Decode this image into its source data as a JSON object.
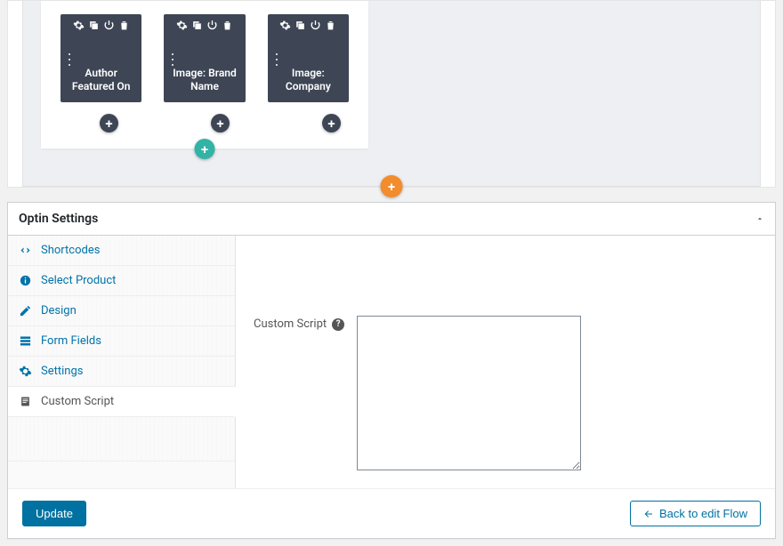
{
  "editor": {
    "modules": [
      {
        "title": "Author Featured On"
      },
      {
        "title": "Image: Brand Name"
      },
      {
        "title": "Image: Company"
      }
    ],
    "icon_names": {
      "gear": "gear-icon",
      "duplicate": "duplicate-icon",
      "power": "power-icon",
      "trash": "trash-icon",
      "drag": "drag-handle-icon",
      "plus": "+"
    }
  },
  "settings_panel": {
    "title": "Optin Settings",
    "tabs": [
      {
        "key": "shortcodes",
        "label": "Shortcodes",
        "icon": "code-icon"
      },
      {
        "key": "select_product",
        "label": "Select Product",
        "icon": "info-icon"
      },
      {
        "key": "design",
        "label": "Design",
        "icon": "pencil-icon"
      },
      {
        "key": "form_fields",
        "label": "Form Fields",
        "icon": "form-icon"
      },
      {
        "key": "settings",
        "label": "Settings",
        "icon": "gear-icon"
      },
      {
        "key": "custom_script",
        "label": "Custom Script",
        "icon": "script-icon"
      }
    ],
    "active_tab": "custom_script",
    "content": {
      "field_label": "Custom Script",
      "help_tooltip": "?",
      "textarea_value": ""
    },
    "footer": {
      "update_label": "Update",
      "back_label": "Back to edit Flow"
    }
  }
}
